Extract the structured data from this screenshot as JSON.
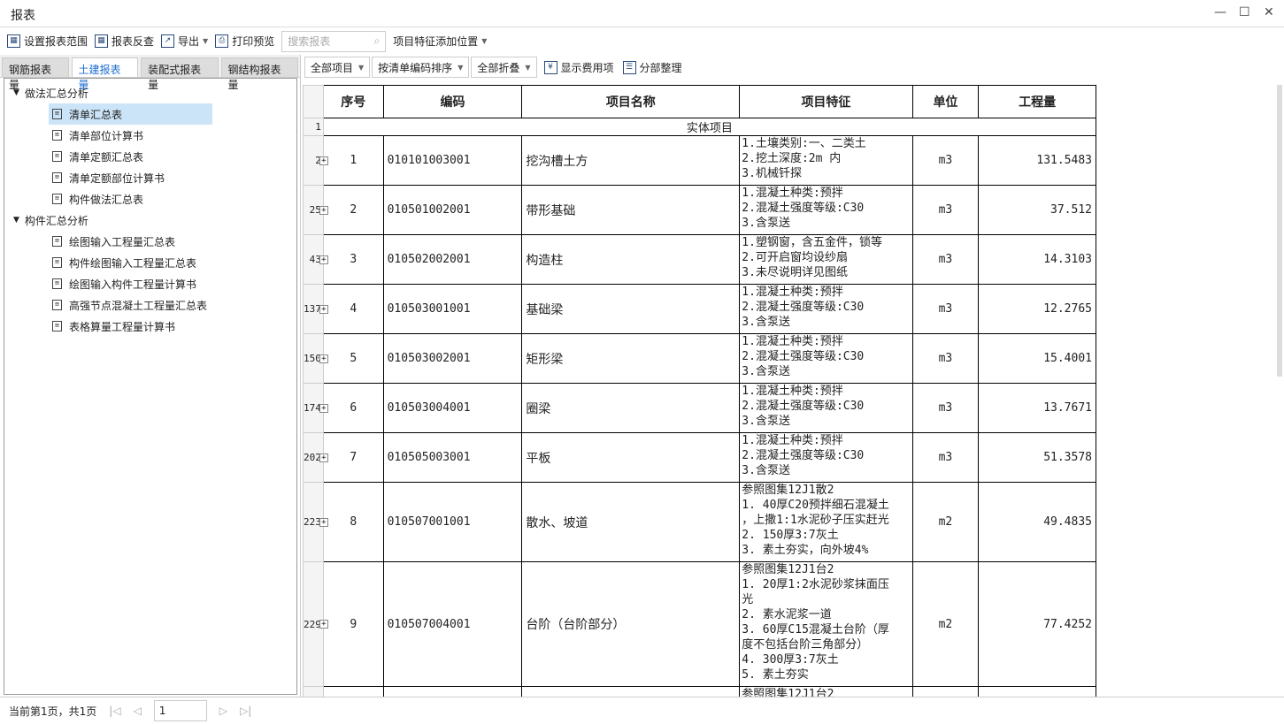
{
  "window": {
    "title": "报表",
    "min": "—",
    "max": "☐",
    "close": "✕"
  },
  "toolbar": {
    "set_range": "设置报表范围",
    "check": "报表反查",
    "export": "导出",
    "print_preview": "打印预览",
    "search_placeholder": "搜索报表",
    "feature_pos": "项目特征添加位置"
  },
  "left_tabs": [
    "钢筋报表量",
    "土建报表量",
    "装配式报表量",
    "钢结构报表量"
  ],
  "tree": [
    {
      "label": "做法汇总分析",
      "items": [
        "清单汇总表",
        "清单部位计算书",
        "清单定额汇总表",
        "清单定额部位计算书",
        "构件做法汇总表"
      ]
    },
    {
      "label": "构件汇总分析",
      "items": [
        "绘图输入工程量汇总表",
        "构件绘图输入工程量汇总表",
        "绘图输入构件工程量计算书",
        "高强节点混凝土工程量汇总表",
        "表格算量工程量计算书"
      ]
    }
  ],
  "right_toolbar": {
    "scope": "全部项目",
    "sort": "按清单编码排序",
    "fold": "全部折叠",
    "show_fee": "显示费用项",
    "organize": "分部整理"
  },
  "table": {
    "headers": [
      "序号",
      "编码",
      "项目名称",
      "项目特征",
      "单位",
      "工程量"
    ],
    "section": {
      "rownum": "1",
      "label": "实体项目"
    },
    "rows": [
      {
        "rn": "2",
        "no": "1",
        "code": "010101003001",
        "name": "挖沟槽土方",
        "feat": "1.土壤类别:一、二类土\n2.挖土深度:2m 内\n3.机械钎探",
        "unit": "m3",
        "qty": "131.5483"
      },
      {
        "rn": "25",
        "no": "2",
        "code": "010501002001",
        "name": "带形基础",
        "feat": "1.混凝土种类:预拌\n2.混凝土强度等级:C30\n3.含泵送",
        "unit": "m3",
        "qty": "37.512"
      },
      {
        "rn": "43",
        "no": "3",
        "code": "010502002001",
        "name": "构造柱",
        "feat": "1.塑钢窗，含五金件，锁等\n2.可开启窗均设纱扇\n3.未尽说明详见图纸",
        "unit": "m3",
        "qty": "14.3103"
      },
      {
        "rn": "137",
        "no": "4",
        "code": "010503001001",
        "name": "基础梁",
        "feat": "1.混凝土种类:预拌\n2.混凝土强度等级:C30\n3.含泵送",
        "unit": "m3",
        "qty": "12.2765"
      },
      {
        "rn": "150",
        "no": "5",
        "code": "010503002001",
        "name": "矩形梁",
        "feat": "1.混凝土种类:预拌\n2.混凝土强度等级:C30\n3.含泵送",
        "unit": "m3",
        "qty": "15.4001"
      },
      {
        "rn": "174",
        "no": "6",
        "code": "010503004001",
        "name": "圈梁",
        "feat": "1.混凝土种类:预拌\n2.混凝土强度等级:C30\n3.含泵送",
        "unit": "m3",
        "qty": "13.7671"
      },
      {
        "rn": "202",
        "no": "7",
        "code": "010505003001",
        "name": "平板",
        "feat": "1.混凝土种类:预拌\n2.混凝土强度等级:C30\n3.含泵送",
        "unit": "m3",
        "qty": "51.3578"
      },
      {
        "rn": "223",
        "no": "8",
        "code": "010507001001",
        "name": "散水、坡道",
        "feat": "参照图集12J1散2\n1. 40厚C20预拌细石混凝土\n，上撒1:1水泥砂子压实赶光\n2. 150厚3:7灰土\n3. 素土夯实，向外坡4%",
        "unit": "m2",
        "qty": "49.4835"
      },
      {
        "rn": "229",
        "no": "9",
        "code": "010507004001",
        "name": "台阶（台阶部分）",
        "feat": "参照图集12J1台2\n1. 20厚1:2水泥砂浆抹面压\n光\n2. 素水泥浆一道\n3. 60厚C15混凝土台阶（厚\n度不包括台阶三角部分）\n4. 300厚3:7灰土\n5. 素土夯实",
        "unit": "m2",
        "qty": "77.4252"
      },
      {
        "rn": "",
        "no": "",
        "code": "",
        "name": "",
        "feat": "参照图集12J1台2",
        "unit": "",
        "qty": ""
      }
    ]
  },
  "footer": {
    "page_info": "当前第1页，共1页",
    "page": "1"
  }
}
